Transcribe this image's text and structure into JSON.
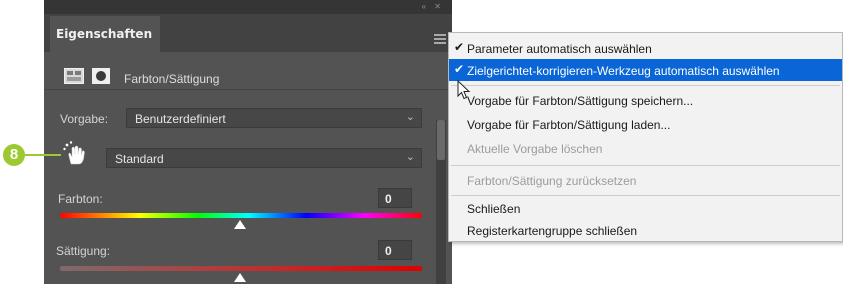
{
  "panel": {
    "tab_label": "Eigenschaften",
    "adjustment_title": "Farbton/Sättigung",
    "preset": {
      "label": "Vorgabe:",
      "value": "Benutzerdefiniert"
    },
    "channel": {
      "value": "Standard"
    },
    "hue": {
      "label": "Farbton:",
      "value": "0"
    },
    "saturation": {
      "label": "Sättigung:",
      "value": "0"
    }
  },
  "callout": {
    "number": "8",
    "color": "#9bc92f"
  },
  "menu": {
    "items": [
      {
        "label": "Parameter automatisch auswählen",
        "checked": true
      },
      {
        "label": "Zielgerichtet-korrigieren-Werkzeug automatisch auswählen",
        "checked": true,
        "highlighted": true
      },
      {
        "label": "Vorgabe für Farbton/Sättigung speichern..."
      },
      {
        "label": "Vorgabe für Farbton/Sättigung laden..."
      },
      {
        "label": "Aktuelle Vorgabe löschen",
        "disabled": true
      },
      {
        "label": "Farbton/Sättigung zurücksetzen",
        "disabled": true
      },
      {
        "label": "Schließen"
      },
      {
        "label": "Registerkartengruppe schließen"
      }
    ],
    "check_glyph": "✔",
    "highlight_color": "#0a66d6"
  },
  "icons": {
    "panel_menu": "hamburger-icon",
    "adjustment_layer": "adjustment-layer-icon",
    "mask": "layer-mask-icon",
    "targeted_adjustment": "hand-icon",
    "dropdown": "chevron-down-icon",
    "pointer": "mouse-cursor-icon"
  },
  "chevron_glyph": "⌄"
}
